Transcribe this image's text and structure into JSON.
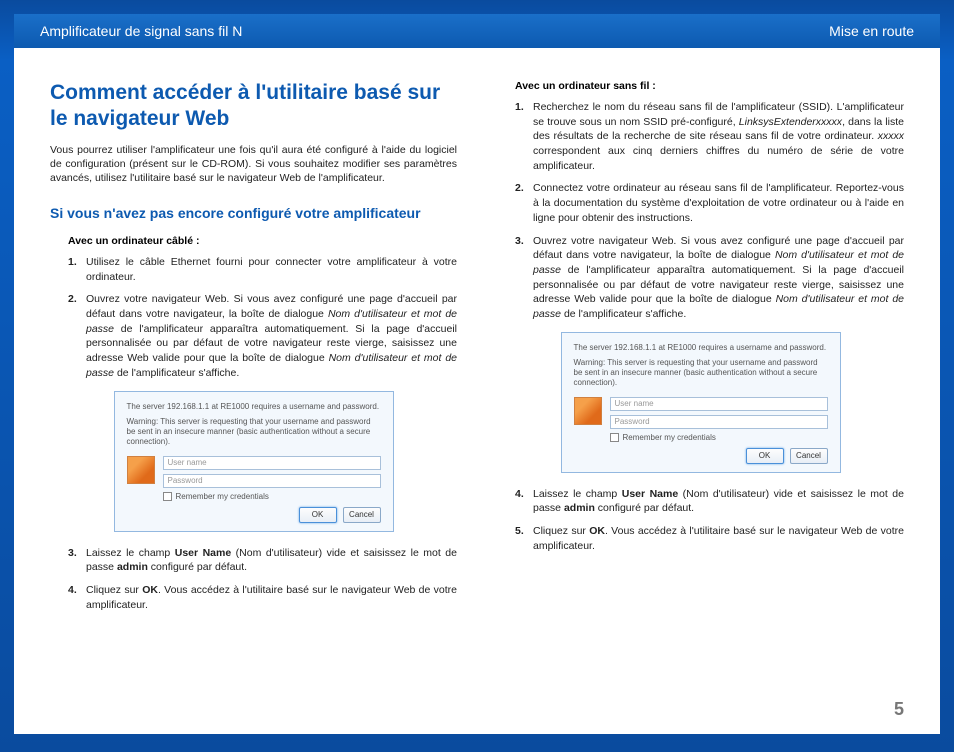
{
  "header": {
    "left": "Amplificateur de signal sans fil N",
    "right": "Mise en route"
  },
  "title": "Comment accéder à l'utilitaire basé sur le navigateur Web",
  "intro": "Vous pourrez utiliser l'amplificateur une fois qu'il aura été configuré à l'aide du logiciel de configuration (présent sur le CD-ROM). Si vous souhaitez modifier ses paramètres avancés, utilisez l'utilitaire basé sur le navigateur Web de l'amplificateur.",
  "section_heading": "Si vous n'avez pas encore configuré votre amplificateur",
  "wired": {
    "heading": "Avec un ordinateur câblé :",
    "steps": {
      "s1": "Utilisez le câble Ethernet fourni pour connecter votre amplificateur à votre ordinateur.",
      "s2_a": "Ouvrez votre navigateur Web. Si vous avez configuré une page d'accueil par défaut dans votre navigateur, la boîte de dialogue ",
      "s2_em1": "Nom d'utilisateur et mot de passe",
      "s2_b": " de l'amplificateur apparaîtra automatiquement. Si la page d'accueil personnalisée ou par défaut de votre navigateur reste vierge, saisissez une adresse Web valide pour que la boîte de dialogue ",
      "s2_em2": "Nom d'utilisateur et mot de passe",
      "s2_c": " de l'amplificateur s'affiche.",
      "s3_a": "Laissez le champ ",
      "s3_bold1": "User Name",
      "s3_b": " (Nom d'utilisateur) vide et saisissez le mot de passe ",
      "s3_bold2": "admin",
      "s3_c": " configuré par défaut.",
      "s4_a": "Cliquez sur ",
      "s4_bold": "OK",
      "s4_b": ". Vous accédez à l'utilitaire basé sur le navigateur Web de votre amplificateur."
    }
  },
  "wireless": {
    "heading": "Avec un ordinateur sans fil :",
    "steps": {
      "s1_a": "Recherchez le nom du réseau sans fil de l'amplificateur (SSID). L'amplificateur se trouve sous un nom SSID pré-configuré, ",
      "s1_em": "LinksysExtenderxxxxx",
      "s1_b": ", dans la liste des résultats de la recherche de site réseau sans fil de votre ordinateur. ",
      "s1_em2": "xxxxx",
      "s1_c": " correspondent aux cinq derniers chiffres du numéro de série de votre amplificateur.",
      "s2": "Connectez votre ordinateur au réseau sans fil de l'amplificateur. Reportez-vous à la documentation du système d'exploitation de votre ordinateur ou à l'aide en ligne pour obtenir des instructions.",
      "s3_a": "Ouvrez votre navigateur Web. Si vous avez configuré une page d'accueil par défaut dans votre navigateur, la boîte de dialogue ",
      "s3_em1": "Nom d'utilisateur et mot de passe",
      "s3_b": " de l'amplificateur apparaîtra automatiquement. Si la page d'accueil personnalisée ou par défaut de votre navigateur reste vierge, saisissez une adresse Web valide pour que la boîte de dialogue ",
      "s3_em2": "Nom d'utilisateur et mot de passe",
      "s3_c": " de l'amplificateur s'affiche.",
      "s4_a": "Laissez le champ ",
      "s4_bold1": "User Name",
      "s4_b": " (Nom d'utilisateur) vide et saisissez le mot de passe ",
      "s4_bold2": "admin",
      "s4_c": " configuré par défaut.",
      "s5_a": "Cliquez sur ",
      "s5_bold": "OK",
      "s5_b": ". Vous accédez à l'utilitaire basé sur le navigateur Web de votre amplificateur."
    }
  },
  "dialog": {
    "server": "The server 192.168.1.1 at RE1000 requires a username and password.",
    "warning": "Warning: This server is requesting that your username and password be sent in an insecure manner (basic authentication without a secure connection).",
    "username_ph": "User name",
    "password_ph": "Password",
    "remember": "Remember my credentials",
    "ok": "OK",
    "cancel": "Cancel"
  },
  "page_number": "5"
}
